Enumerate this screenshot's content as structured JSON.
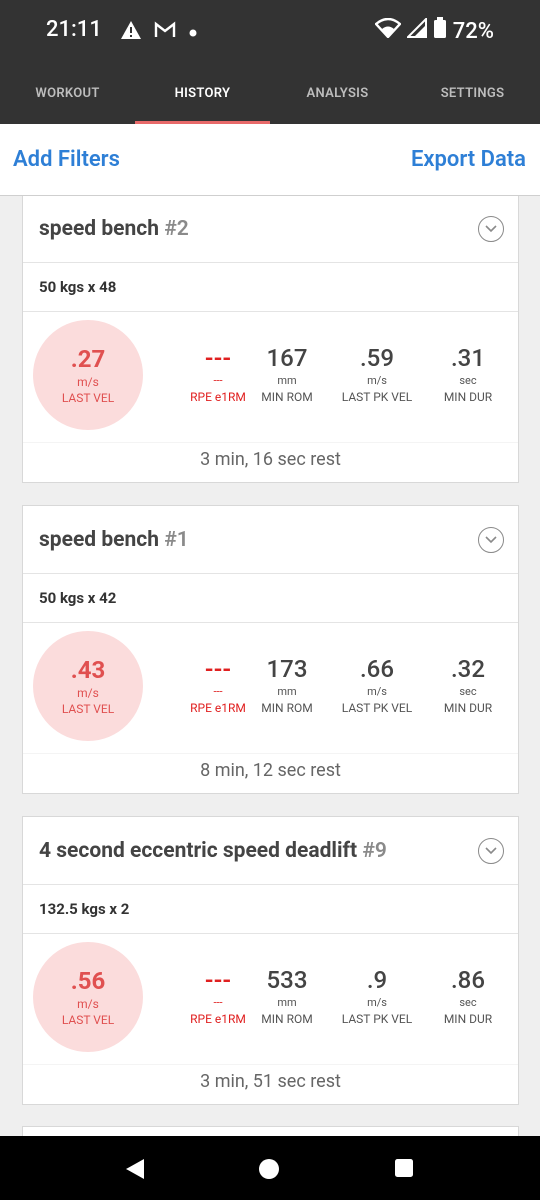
{
  "status": {
    "time": "21:11",
    "battery": "72%"
  },
  "tabs": [
    {
      "label": "WORKOUT"
    },
    {
      "label": "HISTORY"
    },
    {
      "label": "ANALYSIS"
    },
    {
      "label": "SETTINGS"
    }
  ],
  "actions": {
    "add_filters": "Add Filters",
    "export_data": "Export Data"
  },
  "cards": [
    {
      "title": "speed bench",
      "num": "#2",
      "setline": "50 kgs x 48",
      "circle": {
        "val": ".27",
        "unit": "m/s",
        "lbl": "LAST VEL"
      },
      "metrics": [
        {
          "val": "---",
          "unit": "---",
          "lbl": "RPE e1RM"
        },
        {
          "val": "167",
          "unit": "mm",
          "lbl": "MIN ROM"
        },
        {
          "val": ".59",
          "unit": "m/s",
          "lbl": "LAST PK VEL"
        },
        {
          "val": ".31",
          "unit": "sec",
          "lbl": "MIN DUR"
        }
      ],
      "rest": "3 min, 16 sec rest"
    },
    {
      "title": "speed bench",
      "num": "#1",
      "setline": "50 kgs x 42",
      "circle": {
        "val": ".43",
        "unit": "m/s",
        "lbl": "LAST VEL"
      },
      "metrics": [
        {
          "val": "---",
          "unit": "---",
          "lbl": "RPE e1RM"
        },
        {
          "val": "173",
          "unit": "mm",
          "lbl": "MIN ROM"
        },
        {
          "val": ".66",
          "unit": "m/s",
          "lbl": "LAST PK VEL"
        },
        {
          "val": ".32",
          "unit": "sec",
          "lbl": "MIN DUR"
        }
      ],
      "rest": "8 min, 12 sec rest"
    },
    {
      "title": "4 second eccentric speed deadlift",
      "num": "#9",
      "setline": "132.5 kgs x 2",
      "circle": {
        "val": ".56",
        "unit": "m/s",
        "lbl": "LAST VEL"
      },
      "metrics": [
        {
          "val": "---",
          "unit": "---",
          "lbl": "RPE e1RM"
        },
        {
          "val": "533",
          "unit": "mm",
          "lbl": "MIN ROM"
        },
        {
          "val": ".9",
          "unit": "m/s",
          "lbl": "LAST PK VEL"
        },
        {
          "val": ".86",
          "unit": "sec",
          "lbl": "MIN DUR"
        }
      ],
      "rest": "3 min, 51 sec rest"
    }
  ]
}
